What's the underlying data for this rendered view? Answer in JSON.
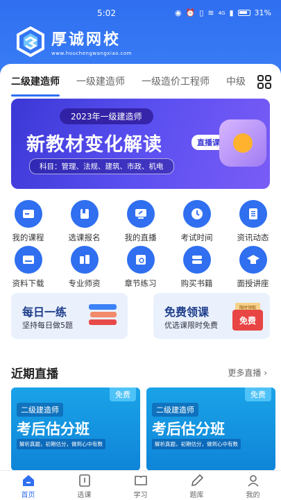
{
  "status_bar": {
    "time": "5:02",
    "battery": "31%",
    "network": "4G"
  },
  "brand": {
    "name": "厚诚网校",
    "domain": "www.houchengwangxiao.com"
  },
  "tabs": [
    {
      "label": "二级建造师",
      "active": true
    },
    {
      "label": "一级建造师"
    },
    {
      "label": "一级造价工程师"
    },
    {
      "label": "中级"
    }
  ],
  "banner": {
    "year_text": "2023年一级建造师",
    "headline": "新教材变化解读",
    "pill": "直播课",
    "subjects": "科目：管理、法规、建筑、市政、机电",
    "page_index": 2,
    "page_count": 4
  },
  "menu": [
    {
      "label": "我的课程",
      "icon": "folder-icon"
    },
    {
      "label": "选课报名",
      "icon": "bookmark-icon"
    },
    {
      "label": "我的直播",
      "icon": "monitor-icon"
    },
    {
      "label": "考试时间",
      "icon": "clock-icon"
    },
    {
      "label": "资讯动态",
      "icon": "document-list-icon"
    },
    {
      "label": "资料下载",
      "icon": "folder-download-icon"
    },
    {
      "label": "专业师资",
      "icon": "teachers-icon"
    },
    {
      "label": "章节练习",
      "icon": "exercise-icon"
    },
    {
      "label": "购买书籍",
      "icon": "books-icon"
    },
    {
      "label": "面授讲座",
      "icon": "graduation-cap-icon"
    }
  ],
  "promos": {
    "daily": {
      "title": "每日一练",
      "subtitle": "坚持每日做5题"
    },
    "free": {
      "title": "免费领课",
      "subtitle": "优选课限时免费",
      "coupon_top": "限时领取",
      "coupon_main": "免费"
    }
  },
  "live_section": {
    "title": "近期直播",
    "more": "更多直播"
  },
  "live_cards": [
    {
      "tag": "免费",
      "level": "二级建造师",
      "name": "考后估分班",
      "desc": "解析真题，初期估分，做到心中有数"
    },
    {
      "tag": "免费",
      "level": "二级建造师",
      "name": "考后估分班",
      "desc": "解析真题，初期估分，做到心中有数"
    }
  ],
  "bottom_nav": [
    {
      "label": "首页",
      "active": true
    },
    {
      "label": "选课"
    },
    {
      "label": "学习"
    },
    {
      "label": "题库"
    },
    {
      "label": "我的"
    }
  ],
  "colors": {
    "primary": "#2f6ff0",
    "banner": "#4a43e6",
    "card": "#1aa3e8"
  }
}
